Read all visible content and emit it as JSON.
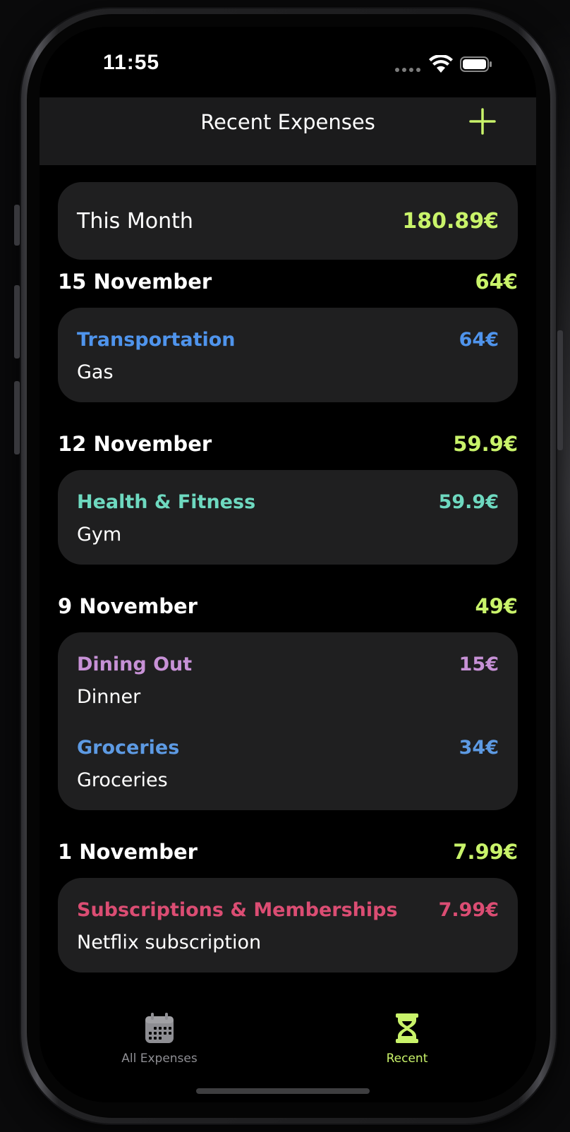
{
  "status_bar": {
    "time": "11:55"
  },
  "nav": {
    "title": "Recent Expenses",
    "add_icon": "plus-icon"
  },
  "colors": {
    "accent": "#c9f36a",
    "transportation": "#4f94ec",
    "health_fitness": "#6ed9c0",
    "dining_out": "#c791d6",
    "groceries": "#5d9ae3",
    "subscriptions": "#db4d73"
  },
  "summary": {
    "label": "This Month",
    "value": "180.89€"
  },
  "groups": [
    {
      "date": "15 November",
      "total": "64€",
      "items": [
        {
          "category": "Transportation",
          "amount": "64€",
          "description": "Gas"
        }
      ]
    },
    {
      "date": "12 November",
      "total": "59.9€",
      "items": [
        {
          "category": "Health & Fitness",
          "amount": "59.9€",
          "description": "Gym"
        }
      ]
    },
    {
      "date": "9 November",
      "total": "49€",
      "items": [
        {
          "category": "Dining Out",
          "amount": "15€",
          "description": "Dinner"
        },
        {
          "category": "Groceries",
          "amount": "34€",
          "description": "Groceries"
        }
      ]
    },
    {
      "date": "1 November",
      "total": "7.99€",
      "items": [
        {
          "category": "Subscriptions & Memberships",
          "amount": "7.99€",
          "description": "Netflix subscription"
        }
      ]
    }
  ],
  "tabs": [
    {
      "label": "All Expenses",
      "icon": "calendar-icon",
      "selected": false
    },
    {
      "label": "Recent",
      "icon": "hourglass-icon",
      "selected": true
    }
  ]
}
